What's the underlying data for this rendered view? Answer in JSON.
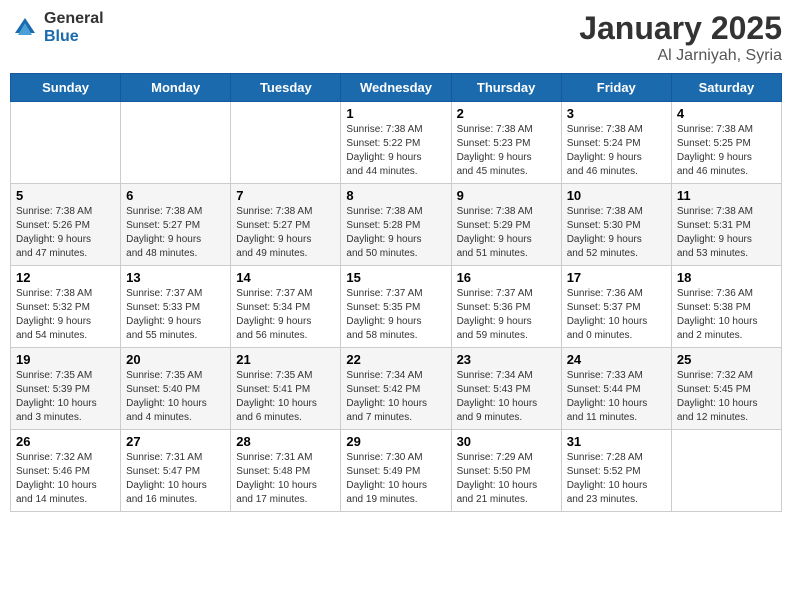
{
  "logo": {
    "general": "General",
    "blue": "Blue"
  },
  "title": "January 2025",
  "subtitle": "Al Jarniyah, Syria",
  "days_header": [
    "Sunday",
    "Monday",
    "Tuesday",
    "Wednesday",
    "Thursday",
    "Friday",
    "Saturday"
  ],
  "weeks": [
    [
      {
        "day": "",
        "info": ""
      },
      {
        "day": "",
        "info": ""
      },
      {
        "day": "",
        "info": ""
      },
      {
        "day": "1",
        "info": "Sunrise: 7:38 AM\nSunset: 5:22 PM\nDaylight: 9 hours\nand 44 minutes."
      },
      {
        "day": "2",
        "info": "Sunrise: 7:38 AM\nSunset: 5:23 PM\nDaylight: 9 hours\nand 45 minutes."
      },
      {
        "day": "3",
        "info": "Sunrise: 7:38 AM\nSunset: 5:24 PM\nDaylight: 9 hours\nand 46 minutes."
      },
      {
        "day": "4",
        "info": "Sunrise: 7:38 AM\nSunset: 5:25 PM\nDaylight: 9 hours\nand 46 minutes."
      }
    ],
    [
      {
        "day": "5",
        "info": "Sunrise: 7:38 AM\nSunset: 5:26 PM\nDaylight: 9 hours\nand 47 minutes."
      },
      {
        "day": "6",
        "info": "Sunrise: 7:38 AM\nSunset: 5:27 PM\nDaylight: 9 hours\nand 48 minutes."
      },
      {
        "day": "7",
        "info": "Sunrise: 7:38 AM\nSunset: 5:27 PM\nDaylight: 9 hours\nand 49 minutes."
      },
      {
        "day": "8",
        "info": "Sunrise: 7:38 AM\nSunset: 5:28 PM\nDaylight: 9 hours\nand 50 minutes."
      },
      {
        "day": "9",
        "info": "Sunrise: 7:38 AM\nSunset: 5:29 PM\nDaylight: 9 hours\nand 51 minutes."
      },
      {
        "day": "10",
        "info": "Sunrise: 7:38 AM\nSunset: 5:30 PM\nDaylight: 9 hours\nand 52 minutes."
      },
      {
        "day": "11",
        "info": "Sunrise: 7:38 AM\nSunset: 5:31 PM\nDaylight: 9 hours\nand 53 minutes."
      }
    ],
    [
      {
        "day": "12",
        "info": "Sunrise: 7:38 AM\nSunset: 5:32 PM\nDaylight: 9 hours\nand 54 minutes."
      },
      {
        "day": "13",
        "info": "Sunrise: 7:37 AM\nSunset: 5:33 PM\nDaylight: 9 hours\nand 55 minutes."
      },
      {
        "day": "14",
        "info": "Sunrise: 7:37 AM\nSunset: 5:34 PM\nDaylight: 9 hours\nand 56 minutes."
      },
      {
        "day": "15",
        "info": "Sunrise: 7:37 AM\nSunset: 5:35 PM\nDaylight: 9 hours\nand 58 minutes."
      },
      {
        "day": "16",
        "info": "Sunrise: 7:37 AM\nSunset: 5:36 PM\nDaylight: 9 hours\nand 59 minutes."
      },
      {
        "day": "17",
        "info": "Sunrise: 7:36 AM\nSunset: 5:37 PM\nDaylight: 10 hours\nand 0 minutes."
      },
      {
        "day": "18",
        "info": "Sunrise: 7:36 AM\nSunset: 5:38 PM\nDaylight: 10 hours\nand 2 minutes."
      }
    ],
    [
      {
        "day": "19",
        "info": "Sunrise: 7:35 AM\nSunset: 5:39 PM\nDaylight: 10 hours\nand 3 minutes."
      },
      {
        "day": "20",
        "info": "Sunrise: 7:35 AM\nSunset: 5:40 PM\nDaylight: 10 hours\nand 4 minutes."
      },
      {
        "day": "21",
        "info": "Sunrise: 7:35 AM\nSunset: 5:41 PM\nDaylight: 10 hours\nand 6 minutes."
      },
      {
        "day": "22",
        "info": "Sunrise: 7:34 AM\nSunset: 5:42 PM\nDaylight: 10 hours\nand 7 minutes."
      },
      {
        "day": "23",
        "info": "Sunrise: 7:34 AM\nSunset: 5:43 PM\nDaylight: 10 hours\nand 9 minutes."
      },
      {
        "day": "24",
        "info": "Sunrise: 7:33 AM\nSunset: 5:44 PM\nDaylight: 10 hours\nand 11 minutes."
      },
      {
        "day": "25",
        "info": "Sunrise: 7:32 AM\nSunset: 5:45 PM\nDaylight: 10 hours\nand 12 minutes."
      }
    ],
    [
      {
        "day": "26",
        "info": "Sunrise: 7:32 AM\nSunset: 5:46 PM\nDaylight: 10 hours\nand 14 minutes."
      },
      {
        "day": "27",
        "info": "Sunrise: 7:31 AM\nSunset: 5:47 PM\nDaylight: 10 hours\nand 16 minutes."
      },
      {
        "day": "28",
        "info": "Sunrise: 7:31 AM\nSunset: 5:48 PM\nDaylight: 10 hours\nand 17 minutes."
      },
      {
        "day": "29",
        "info": "Sunrise: 7:30 AM\nSunset: 5:49 PM\nDaylight: 10 hours\nand 19 minutes."
      },
      {
        "day": "30",
        "info": "Sunrise: 7:29 AM\nSunset: 5:50 PM\nDaylight: 10 hours\nand 21 minutes."
      },
      {
        "day": "31",
        "info": "Sunrise: 7:28 AM\nSunset: 5:52 PM\nDaylight: 10 hours\nand 23 minutes."
      },
      {
        "day": "",
        "info": ""
      }
    ]
  ]
}
